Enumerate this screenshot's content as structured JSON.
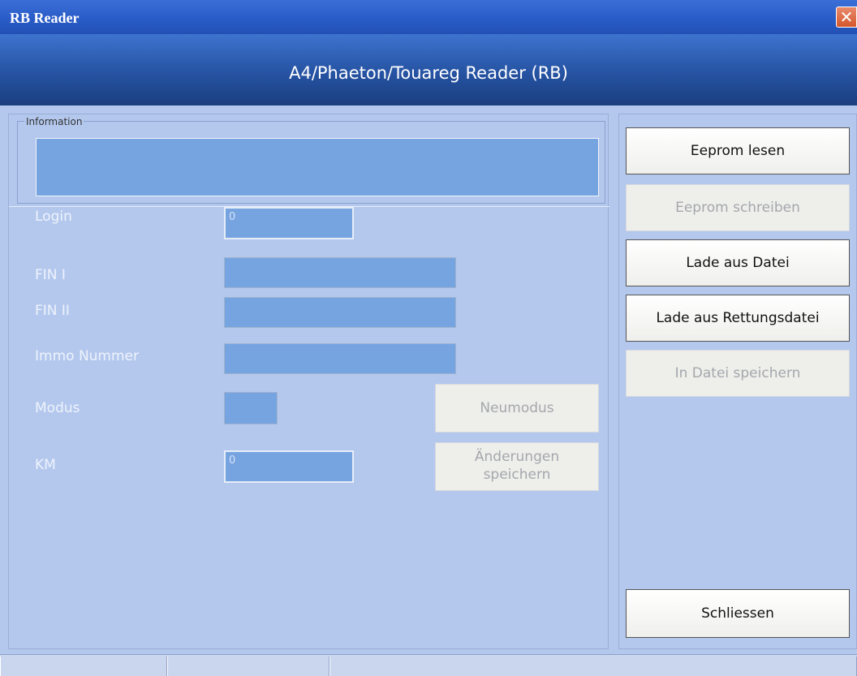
{
  "window": {
    "title": "RB Reader",
    "close_glyph": "✕"
  },
  "banner": {
    "title": "A4/Phaeton/Touareg Reader (RB)"
  },
  "information": {
    "legend": "Information",
    "value": ""
  },
  "form": {
    "login": {
      "label": "Login",
      "value": "0"
    },
    "fin1": {
      "label": "FIN I",
      "value": ""
    },
    "fin2": {
      "label": "FIN II",
      "value": ""
    },
    "immo": {
      "label": "Immo Nummer",
      "value": ""
    },
    "modus": {
      "label": "Modus",
      "value": ""
    },
    "km": {
      "label": "KM",
      "value": "0"
    },
    "neumodus_label": "Neumodus",
    "save_changes_label_1": "Änderungen",
    "save_changes_label_2": "speichern"
  },
  "actions": {
    "read_eeprom": "Eeprom lesen",
    "write_eeprom": "Eeprom schreiben",
    "load_file": "Lade aus Datei",
    "load_rescue": "Lade aus Rettungsdatei",
    "save_file": "In Datei speichern",
    "close": "Schliessen"
  }
}
